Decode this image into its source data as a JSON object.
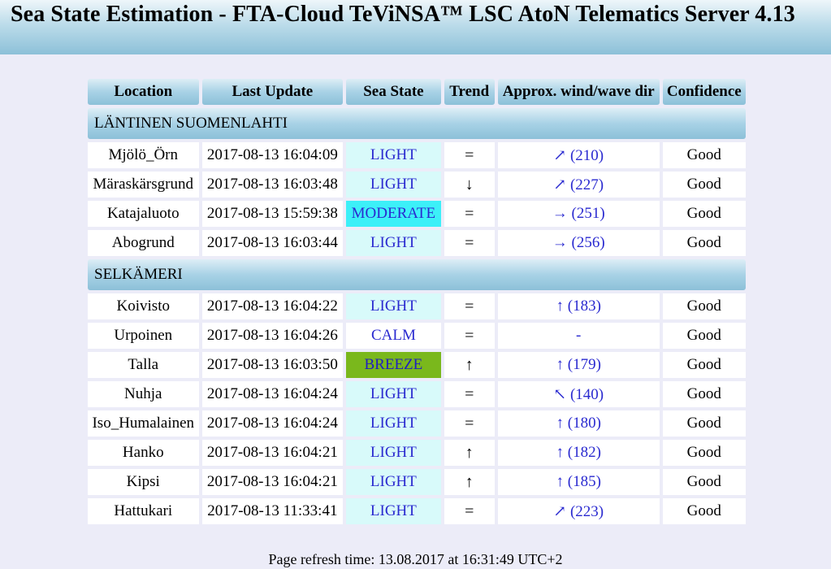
{
  "header": {
    "title": "Sea State Estimation - FTA-Cloud TeViNSA™ LSC AtoN Telematics Server 4.13"
  },
  "table": {
    "columns": [
      "Location",
      "Last Update",
      "Sea State",
      "Trend",
      "Approx. wind/wave dir",
      "Confidence"
    ],
    "sections": [
      {
        "name": "LÄNTINEN SUOMENLAHTI",
        "rows": [
          {
            "location": "Mjölö_Örn",
            "last_update": "2017-08-13 16:04:09",
            "sea_state": "LIGHT",
            "state_class": "light",
            "trend": "=",
            "dir": "↗ (210)",
            "confidence": "Good"
          },
          {
            "location": "Märaskärsgrund",
            "last_update": "2017-08-13 16:03:48",
            "sea_state": "LIGHT",
            "state_class": "light",
            "trend": "↓",
            "dir": "↗ (227)",
            "confidence": "Good"
          },
          {
            "location": "Katajaluoto",
            "last_update": "2017-08-13 15:59:38",
            "sea_state": "MODERATE",
            "state_class": "moderate",
            "trend": "=",
            "dir": "→ (251)",
            "confidence": "Good"
          },
          {
            "location": "Abogrund",
            "last_update": "2017-08-13 16:03:44",
            "sea_state": "LIGHT",
            "state_class": "light",
            "trend": "=",
            "dir": "→ (256)",
            "confidence": "Good"
          }
        ]
      },
      {
        "name": "SELKÄMERI",
        "rows": [
          {
            "location": "Koivisto",
            "last_update": "2017-08-13 16:04:22",
            "sea_state": "LIGHT",
            "state_class": "light",
            "trend": "=",
            "dir": "↑ (183)",
            "confidence": "Good"
          },
          {
            "location": "Urpoinen",
            "last_update": "2017-08-13 16:04:26",
            "sea_state": "CALM",
            "state_class": "calm",
            "trend": "=",
            "dir": "-",
            "confidence": "Good"
          },
          {
            "location": "Talla",
            "last_update": "2017-08-13 16:03:50",
            "sea_state": "BREEZE",
            "state_class": "breeze",
            "trend": "↑",
            "dir": "↑ (179)",
            "confidence": "Good"
          },
          {
            "location": "Nuhja",
            "last_update": "2017-08-13 16:04:24",
            "sea_state": "LIGHT",
            "state_class": "light",
            "trend": "=",
            "dir": "↖ (140)",
            "confidence": "Good"
          },
          {
            "location": "Iso_Humalainen",
            "last_update": "2017-08-13 16:04:24",
            "sea_state": "LIGHT",
            "state_class": "light",
            "trend": "=",
            "dir": "↑ (180)",
            "confidence": "Good"
          },
          {
            "location": "Hanko",
            "last_update": "2017-08-13 16:04:21",
            "sea_state": "LIGHT",
            "state_class": "light",
            "trend": "↑",
            "dir": "↑ (182)",
            "confidence": "Good"
          },
          {
            "location": "Kipsi",
            "last_update": "2017-08-13 16:04:21",
            "sea_state": "LIGHT",
            "state_class": "light",
            "trend": "↑",
            "dir": "↑ (185)",
            "confidence": "Good"
          },
          {
            "location": "Hattukari",
            "last_update": "2017-08-13 11:33:41",
            "sea_state": "LIGHT",
            "state_class": "light",
            "trend": "=",
            "dir": "↗ (223)",
            "confidence": "Good"
          }
        ]
      }
    ]
  },
  "footer": {
    "refresh_text": "Page refresh time: 13.08.2017 at 16:31:49 UTC+2"
  },
  "colors": {
    "light_bg": "#d8fafa",
    "moderate_bg": "#3cf0f8",
    "breeze_bg": "#7ab81c",
    "state_text": "#2a2ad0",
    "header_gradient_end": "#8cc0d8",
    "page_bg": "#ececf8"
  }
}
